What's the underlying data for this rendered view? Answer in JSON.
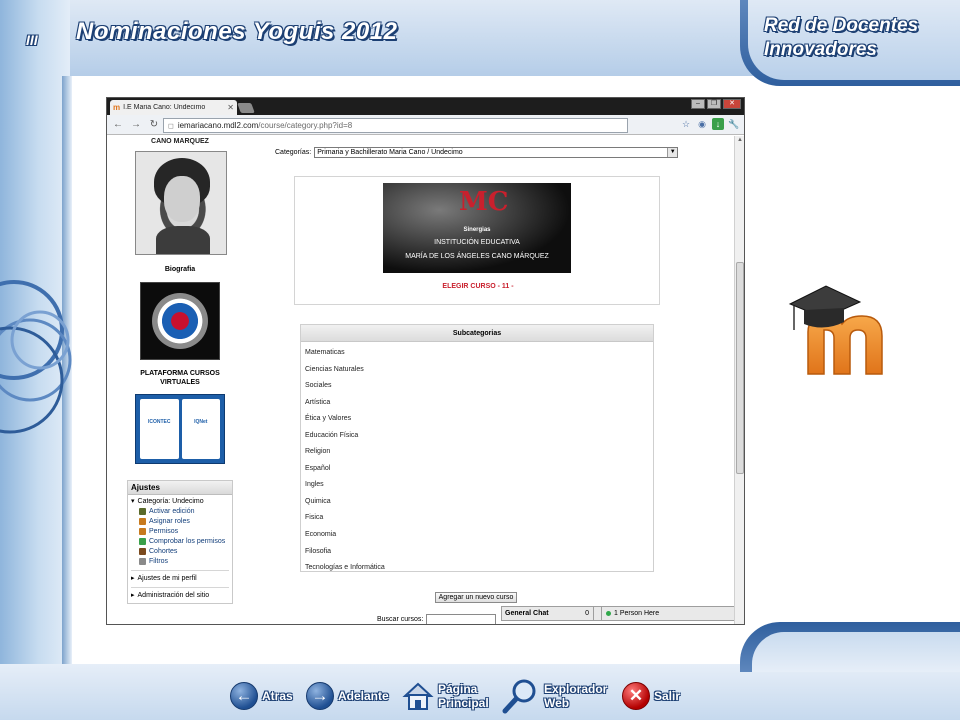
{
  "slide": {
    "roman": "III",
    "title": "Nominaciones Yoguis 2012",
    "network_line1": "Red de Docentes",
    "network_line2": "Innovadores"
  },
  "browser": {
    "tab_title": "I.E Maria Cano: Undecimo",
    "url_host": "iemariacano.mdl2.com",
    "url_path": "/course/category.php?id=8"
  },
  "left_column": {
    "header": "CANO MARQUEZ",
    "bio_label": "Biografia",
    "platform_line1": "PLATAFORMA CURSOS",
    "platform_line2": "VIRTUALES",
    "cert_left": "ICONTEC",
    "cert_right": "IQNet"
  },
  "settings": {
    "title": "Ajustes",
    "category_node": "Categoría: Undecimo",
    "items": [
      {
        "label": "Activar edición",
        "color": "#5a6a2a"
      },
      {
        "label": "Asignar roles",
        "color": "#c77a1e"
      },
      {
        "label": "Permisos",
        "color": "#c77a1e"
      },
      {
        "label": "Comprobar los permisos",
        "color": "#3aa04a"
      },
      {
        "label": "Cohortes",
        "color": "#7a4a1e"
      },
      {
        "label": "Filtros",
        "color": "#8a8a8a"
      }
    ],
    "profile_node": "Ajustes de mi perfil",
    "site_admin_node": "Administración del sitio"
  },
  "main": {
    "category_label": "Categorías:",
    "category_value": "Primaria y Bachillerato Maria Cano / Undecimo",
    "banner_sinergias": "Sinergias",
    "banner_line1": "INSTITUCIÓN EDUCATIVA",
    "banner_line2": "MARÍA DE LOS ÁNGELES CANO MÁRQUEZ",
    "choose_course": "ELEGIR CURSO - 11 -",
    "subcategories_title": "Subcategorias",
    "subcategories": [
      "Matematicas",
      "Ciencias Naturales",
      "Sociales",
      "Artística",
      "Ética y Valores",
      "Educación Física",
      "Religion",
      "Español",
      "Ingles",
      "Quimica",
      "Fisica",
      "Economia",
      "Filosofia",
      "Tecnologías e Informática"
    ],
    "add_course_button": "Agregar un nuevo curso",
    "search_label": "Buscar cursos:"
  },
  "chat": {
    "general_chat": "General Chat",
    "count": "0",
    "online": "1 Person Here"
  },
  "nav": {
    "back": "Atras",
    "forward": "Adelante",
    "home_line1": "Página",
    "home_line2": "Principal",
    "explorer_line1": "Explorador",
    "explorer_line2": "Web",
    "exit": "Salir"
  }
}
